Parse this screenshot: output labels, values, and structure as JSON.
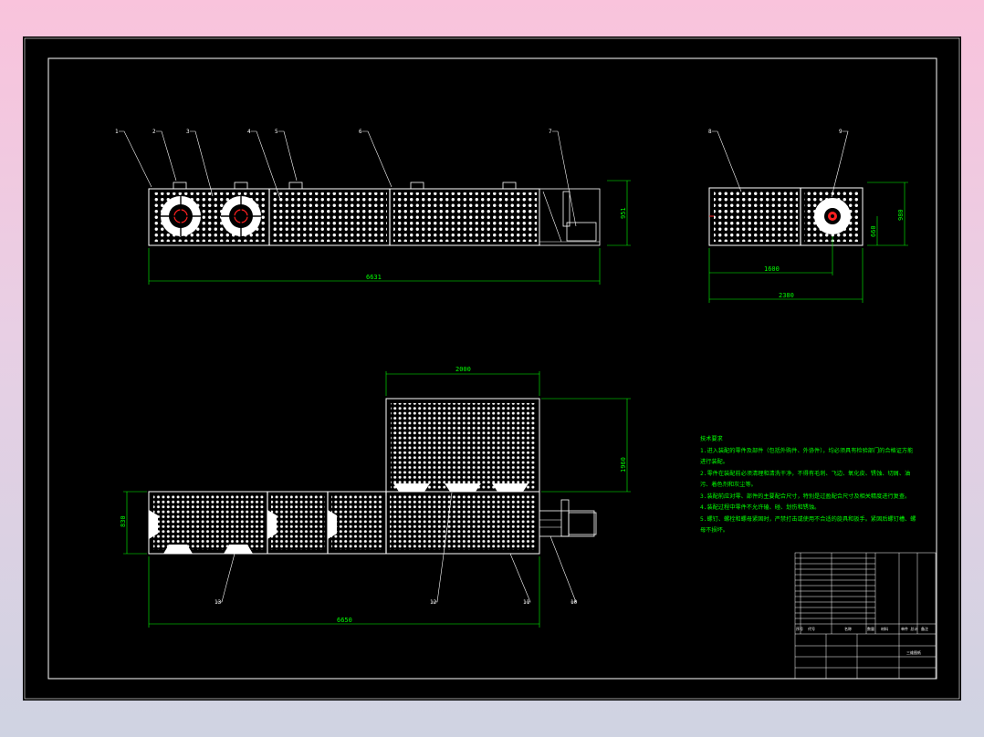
{
  "colors": {
    "background": "#000000",
    "frame": "#ffffff",
    "dimension": "#00ff00",
    "callout": "#ffffff",
    "center_mark": "#ff2020"
  },
  "views": {
    "front": {
      "callouts": [
        "1",
        "2",
        "3",
        "4",
        "5",
        "6",
        "7"
      ],
      "dim_width": "6631",
      "dim_height": "951"
    },
    "side": {
      "callouts": [
        "8",
        "9"
      ],
      "dim_inner": "1600",
      "dim_total": "2380",
      "dim_height": "980",
      "dim_mid": "660"
    },
    "top": {
      "callouts": [
        "13",
        "12",
        "11",
        "10"
      ],
      "dim_upper_width": "2000",
      "dim_upper_height": "1960",
      "dim_lower_height": "830",
      "dim_overall": "6650"
    }
  },
  "notes": {
    "heading": "技术要求",
    "lines": [
      "1.进入装配的零件及部件（包括外购件、外协件），均必须具有检验部门的合格证方能",
      "进行装配。",
      "2.零件在装配前必须清理和清洗干净，不得有毛刺、飞边、氧化皮、锈蚀、切屑、油",
      "污、着色剂和灰尘等。",
      "3.装配前应对零、部件的主要配合尺寸，特别是过盈配合尺寸及相关精度进行复查。",
      "4.装配过程中零件不允许磕、碰、划伤和锈蚀。",
      "5.螺钉、螺栓和螺母紧固时，严禁打击或使用不合适的旋具和扳手。紧固后螺钉槽、螺",
      "母不损坏。"
    ]
  },
  "title_block": {
    "header": [
      "序号",
      "代号",
      "名称",
      "数量",
      "材料",
      "单件 总计",
      "备注"
    ],
    "drawing_name": "三维图纸"
  }
}
